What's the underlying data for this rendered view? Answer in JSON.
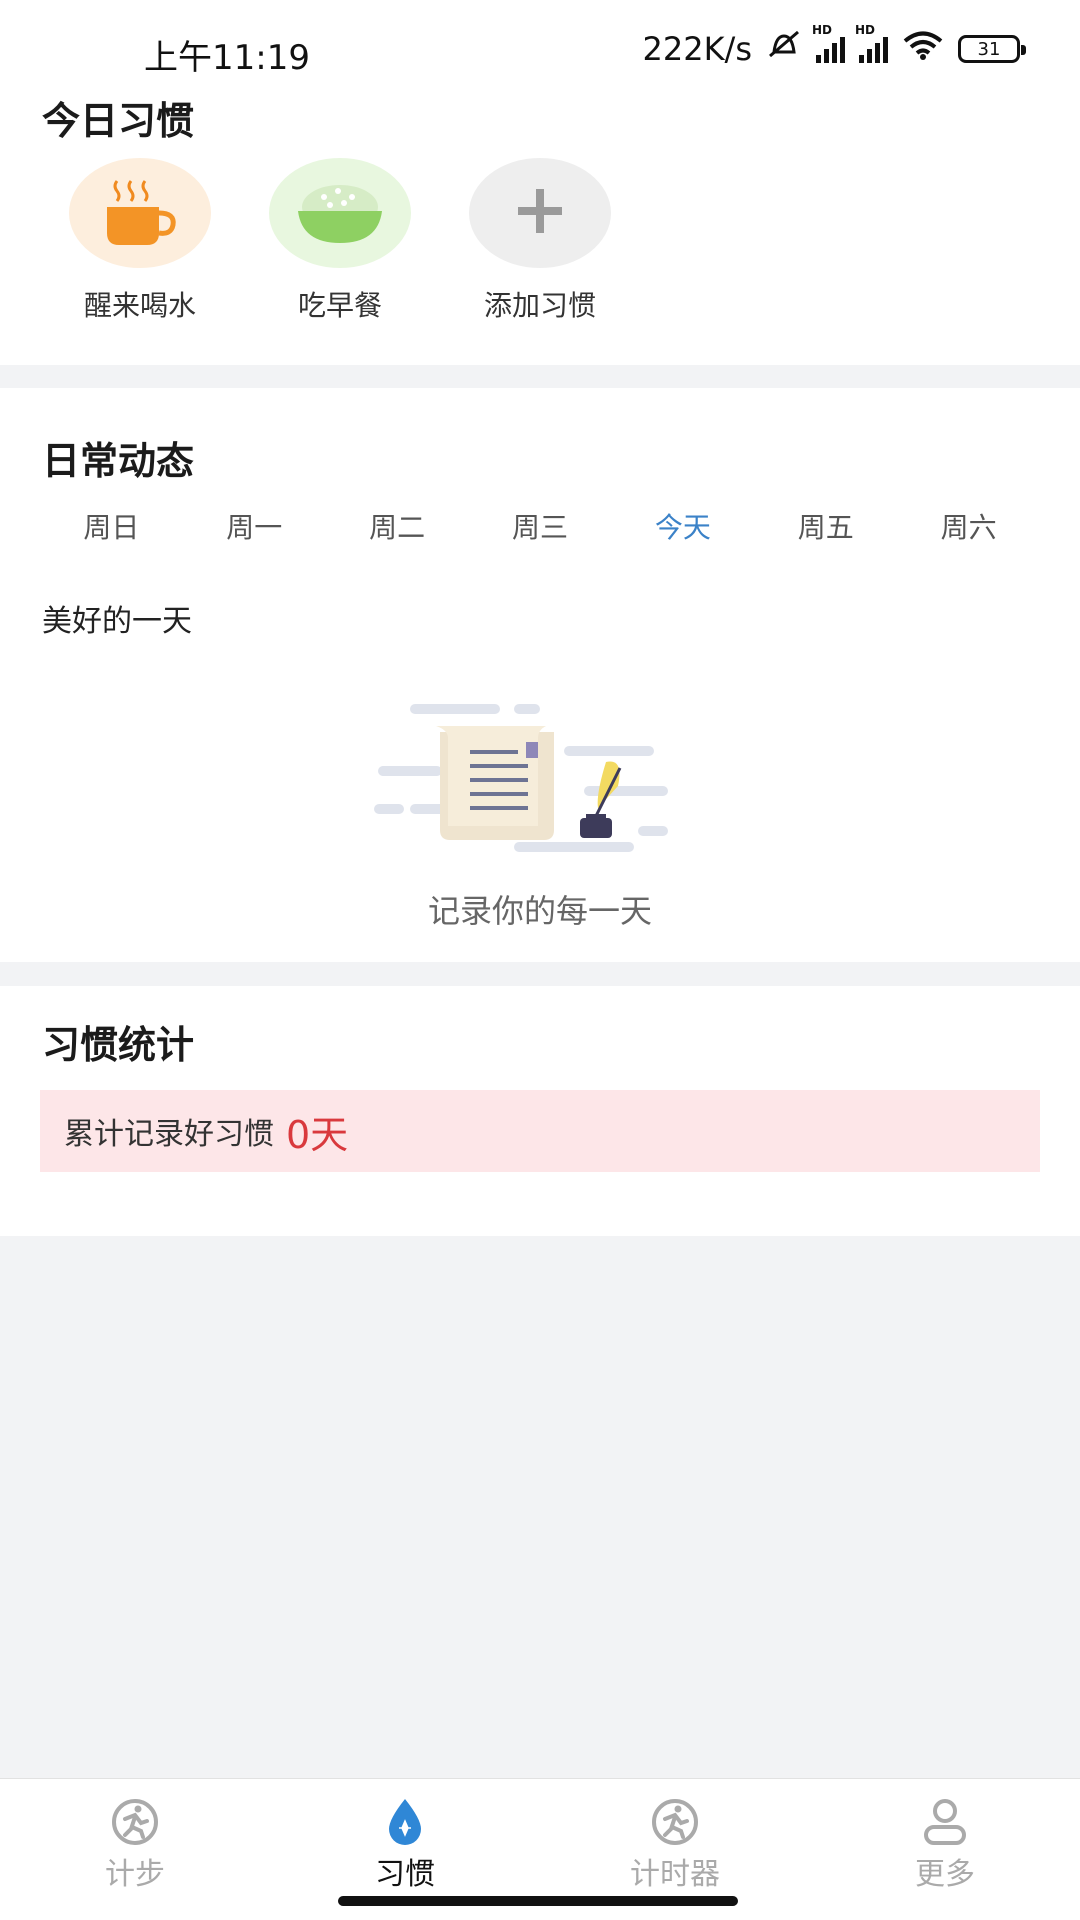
{
  "status_bar": {
    "time": "上午11:19",
    "speed": "222K/s",
    "battery": "31"
  },
  "today_habits": {
    "title": "今日习惯",
    "items": [
      {
        "label": "醒来喝水",
        "icon": "coffee-cup-icon",
        "bg": "#fdeedd"
      },
      {
        "label": "吃早餐",
        "icon": "rice-bowl-icon",
        "bg": "#e8f7df"
      },
      {
        "label": "添加习惯",
        "icon": "plus-icon",
        "bg": "#eeeeee"
      }
    ]
  },
  "daily": {
    "title": "日常动态",
    "days": [
      "周日",
      "周一",
      "周二",
      "周三",
      "今天",
      "周五",
      "周六"
    ],
    "active_day": "今天",
    "subtitle": "美好的一天",
    "empty_text": "记录你的每一天"
  },
  "stats": {
    "title": "习惯统计",
    "label": "累计记录好习惯",
    "value": "0天"
  },
  "bottom_nav": {
    "items": [
      {
        "label": "计步",
        "icon": "runner-icon",
        "active": false
      },
      {
        "label": "习惯",
        "icon": "water-drop-icon",
        "active": true
      },
      {
        "label": "计时器",
        "icon": "runner-icon",
        "active": false
      },
      {
        "label": "更多",
        "icon": "person-icon",
        "active": false
      }
    ]
  },
  "colors": {
    "accent": "#3b82c8",
    "stat_value": "#d9393d",
    "stat_bg": "#fde6e8"
  }
}
